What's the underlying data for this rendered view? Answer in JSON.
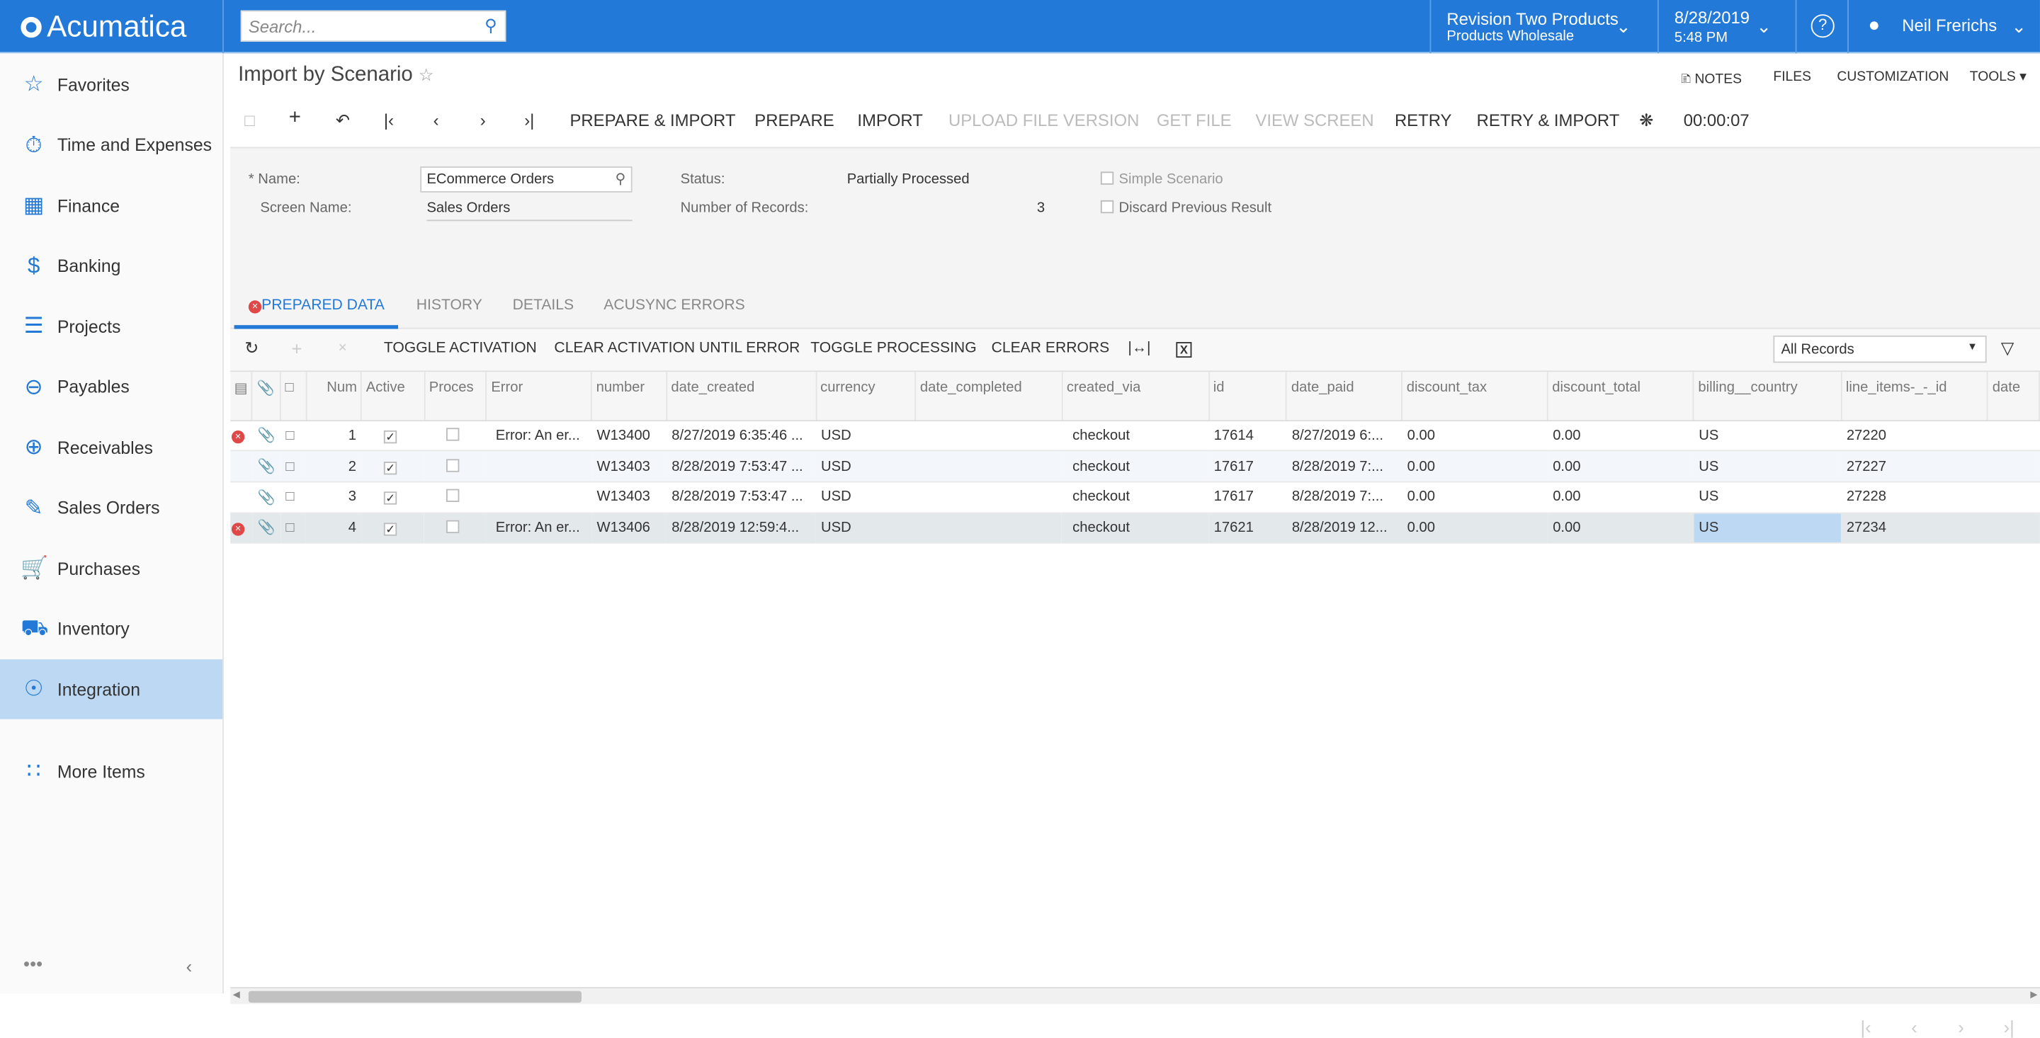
{
  "app": {
    "logo": "Acumatica",
    "search_placeholder": "Search...",
    "branch": "Revision Two Products",
    "company": "Products Wholesale",
    "date": "8/28/2019",
    "time": "5:48 PM",
    "user": "Neil Frerichs",
    "accent": "#2279d8"
  },
  "sidebar": {
    "items": [
      {
        "label": "Favorites",
        "icon": "star-icon"
      },
      {
        "label": "Time and Expenses",
        "icon": "stopwatch-icon"
      },
      {
        "label": "Finance",
        "icon": "calculator-icon"
      },
      {
        "label": "Banking",
        "icon": "dollar-icon"
      },
      {
        "label": "Projects",
        "icon": "projects-icon"
      },
      {
        "label": "Payables",
        "icon": "minus-circle-icon"
      },
      {
        "label": "Receivables",
        "icon": "plus-circle-icon"
      },
      {
        "label": "Sales Orders",
        "icon": "edit-icon"
      },
      {
        "label": "Purchases",
        "icon": "cart-icon"
      },
      {
        "label": "Inventory",
        "icon": "truck-icon"
      },
      {
        "label": "Integration",
        "icon": "integration-icon",
        "selected": true
      },
      {
        "label": "More Items",
        "icon": "grid-icon"
      }
    ]
  },
  "page": {
    "title": "Import by Scenario"
  },
  "toolbar": {
    "prepare_import": "PREPARE & IMPORT",
    "prepare": "PREPARE",
    "import": "IMPORT",
    "upload": "UPLOAD FILE VERSION",
    "get_file": "GET FILE",
    "view_screen": "VIEW SCREEN",
    "retry": "RETRY",
    "retry_import": "RETRY & IMPORT",
    "timer": "00:00:07",
    "notes": "NOTES",
    "files": "FILES",
    "customization": "CUSTOMIZATION",
    "tools": "TOOLS"
  },
  "form": {
    "name_label": "* Name:",
    "name_value": "ECommerce Orders",
    "screen_label": "Screen Name:",
    "screen_value": "Sales Orders",
    "status_label": "Status:",
    "status_value": "Partially Processed",
    "records_label": "Number of Records:",
    "records_value": "3",
    "simple_scenario": "Simple Scenario",
    "discard_previous": "Discard Previous Result"
  },
  "tabs": [
    "PREPARED DATA",
    "HISTORY",
    "DETAILS",
    "ACUSYNC ERRORS"
  ],
  "grid_toolbar": {
    "toggle_activation": "TOGGLE ACTIVATION",
    "clear_activation": "CLEAR ACTIVATION UNTIL ERROR",
    "toggle_processing": "TOGGLE PROCESSING",
    "clear_errors": "CLEAR ERRORS",
    "filter": "All Records"
  },
  "grid": {
    "columns": [
      "Num",
      "Active",
      "Proces",
      "Error",
      "number",
      "date_created",
      "currency",
      "date_completed",
      "created_via",
      "id",
      "date_paid",
      "discount_tax",
      "discount_total",
      "billing__country",
      "line_items-_-_id",
      "date"
    ],
    "rows": [
      {
        "error": true,
        "num": "1",
        "active": true,
        "processed": false,
        "error_text": "Error: An er...",
        "number": "W13400",
        "date_created": "8/27/2019 6:35:46 ...",
        "currency": "USD",
        "date_completed": "",
        "created_via": "checkout",
        "id": "17614",
        "date_paid": "8/27/2019 6:...",
        "discount_tax": "0.00",
        "discount_total": "0.00",
        "billing_country": "US",
        "line_items_id": "27220"
      },
      {
        "error": false,
        "num": "2",
        "active": true,
        "processed": false,
        "error_text": "",
        "number": "W13403",
        "date_created": "8/28/2019 7:53:47 ...",
        "currency": "USD",
        "date_completed": "",
        "created_via": "checkout",
        "id": "17617",
        "date_paid": "8/28/2019 7:...",
        "discount_tax": "0.00",
        "discount_total": "0.00",
        "billing_country": "US",
        "line_items_id": "27227"
      },
      {
        "error": false,
        "num": "3",
        "active": true,
        "processed": false,
        "error_text": "",
        "number": "W13403",
        "date_created": "8/28/2019 7:53:47 ...",
        "currency": "USD",
        "date_completed": "",
        "created_via": "checkout",
        "id": "17617",
        "date_paid": "8/28/2019 7:...",
        "discount_tax": "0.00",
        "discount_total": "0.00",
        "billing_country": "US",
        "line_items_id": "27228"
      },
      {
        "error": true,
        "num": "4",
        "active": true,
        "processed": false,
        "error_text": "Error: An er...",
        "number": "W13406",
        "date_created": "8/28/2019 12:59:4...",
        "currency": "USD",
        "date_completed": "",
        "created_via": "checkout",
        "id": "17621",
        "date_paid": "8/28/2019 12...",
        "discount_tax": "0.00",
        "discount_total": "0.00",
        "billing_country": "US",
        "line_items_id": "27234",
        "current": true
      }
    ]
  }
}
